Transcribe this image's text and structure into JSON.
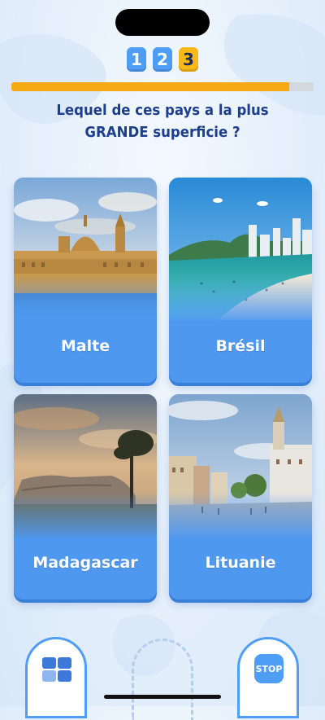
{
  "progress": {
    "steps": [
      "1",
      "2",
      "3"
    ],
    "current_step": 3,
    "fill_fraction": 0.92
  },
  "question": {
    "text": "Lequel de ces pays a la plus GRANDE superficie ?"
  },
  "answers": [
    {
      "label": "Malte",
      "scene": "baroque-city-harbor"
    },
    {
      "label": "Brésil",
      "scene": "copacabana-beach"
    },
    {
      "label": "Madagascar",
      "scene": "sunset-savanna-baobab"
    },
    {
      "label": "Lituanie",
      "scene": "old-town-square"
    }
  ],
  "bottom_bar": {
    "stop_label": "STOP",
    "menu_icon": "grid-icon"
  },
  "colors": {
    "accent": "#4f9ef5",
    "progress": "#f5aa14",
    "question_text": "#1d3e8c",
    "card": "#4f98f0"
  }
}
